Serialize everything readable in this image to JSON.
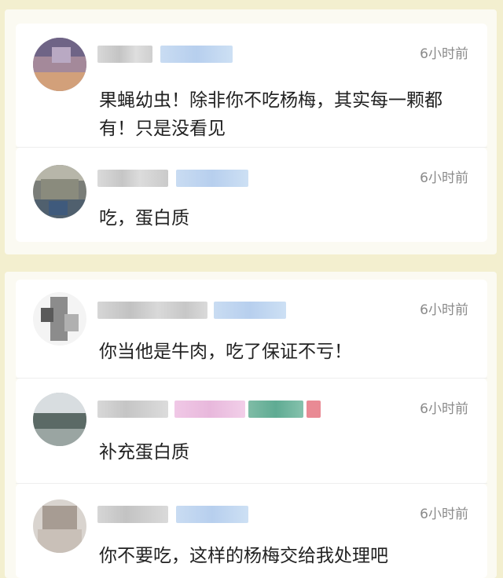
{
  "comments": [
    {
      "time": "6小时前",
      "text": "果蝇幼虫！除非你不吃杨梅，其实每一颗都有！只是没看见"
    },
    {
      "time": "6小时前",
      "text": "吃，蛋白质"
    },
    {
      "time": "6小时前",
      "text": "你当他是牛肉，吃了保证不亏！"
    },
    {
      "time": "6小时前",
      "text": "补充蛋白质"
    },
    {
      "time": "6小时前",
      "text": "你不要吃，这样的杨梅交给我处理吧"
    }
  ],
  "colors": {
    "page_background": "#f3efcf",
    "card": "#ffffff",
    "timestamp": "#8a8a8a",
    "comment_text": "#222222"
  }
}
